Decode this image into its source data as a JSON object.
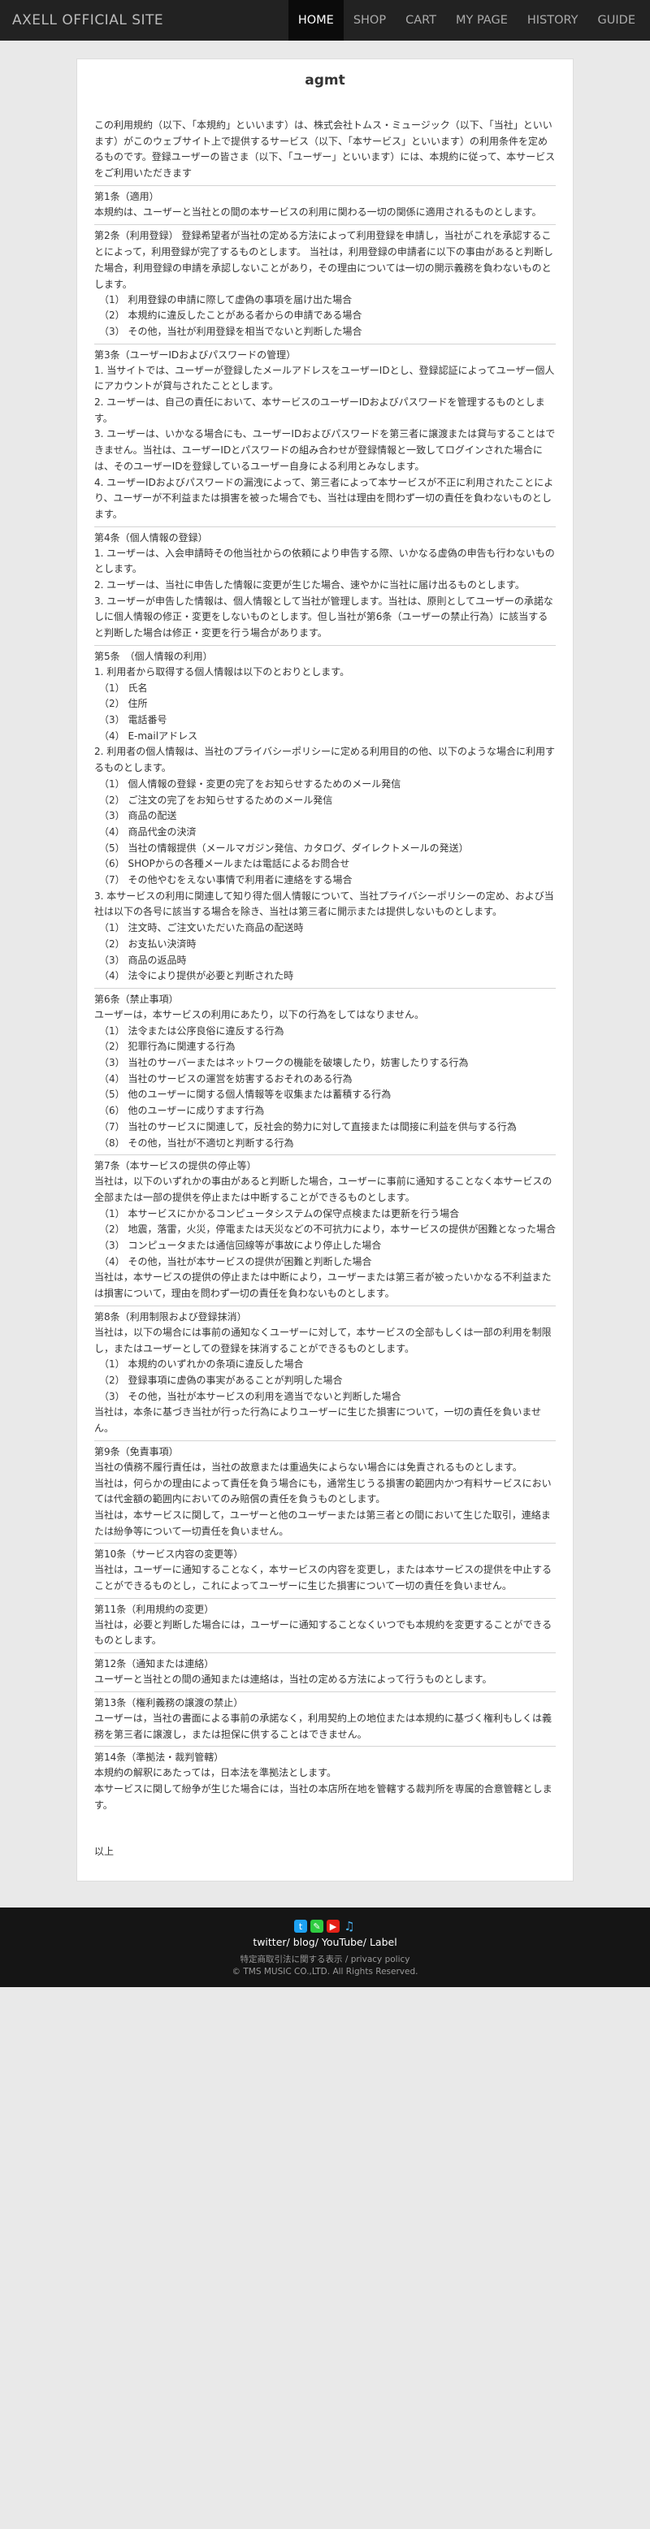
{
  "header": {
    "brand": "AXELL OFFICIAL SITE",
    "nav": [
      {
        "label": "HOME",
        "active": true
      },
      {
        "label": "SHOP",
        "active": false
      },
      {
        "label": "CART",
        "active": false
      },
      {
        "label": "MY PAGE",
        "active": false
      },
      {
        "label": "HISTORY",
        "active": false
      },
      {
        "label": "GUIDE",
        "active": false
      }
    ]
  },
  "doc": {
    "title": "agmt",
    "intro": "この利用規約（以下、「本規約」といいます）は、株式会社トムス・ミュージック（以下、「当社」といいます）がこのウェブサイト上で提供するサービス（以下、「本サービス」といいます）の利用条件を定めるものです。登録ユーザーの皆さま（以下、「ユーザー」といいます）には、本規約に従って、本サービスをご利用いただきます",
    "sections": [
      {
        "title": "第1条（適用）",
        "lines": [
          {
            "kind": "p",
            "text": "本規約は、ユーザーと当社との間の本サービスの利用に関わる一切の関係に適用されるものとします。"
          }
        ]
      },
      {
        "title": "第2条（利用登録） 登録希望者が当社の定める方法によって利用登録を申請し，当社がこれを承認することによって，利用登録が完了するものとします。 当社は，利用登録の申請者に以下の事由があると判断した場合，利用登録の申請を承認しないことがあり，その理由については一切の開示義務を負わないものとします。",
        "lines": [
          {
            "kind": "i",
            "text": "（1） 利用登録の申請に際して虚偽の事項を届け出た場合"
          },
          {
            "kind": "i",
            "text": "（2） 本規約に違反したことがある者からの申請である場合"
          },
          {
            "kind": "i",
            "text": "（3） その他，当社が利用登録を相当でないと判断した場合"
          }
        ]
      },
      {
        "title": "第3条（ユーザーIDおよびパスワードの管理）",
        "lines": [
          {
            "kind": "p",
            "text": "1. 当サイトでは、ユーザーが登録したメールアドレスをユーザーIDとし、登録認証によってユーザー個人にアカウントが貸与されたこととします。"
          },
          {
            "kind": "p",
            "text": "2. ユーザーは、自己の責任において、本サービスのユーザーIDおよびパスワードを管理するものとします。"
          },
          {
            "kind": "p",
            "text": "3. ユーザーは、いかなる場合にも、ユーザーIDおよびパスワードを第三者に譲渡または貸与することはできません。当社は、ユーザーIDとパスワードの組み合わせが登録情報と一致してログインされた場合には、そのユーザーIDを登録しているユーザー自身による利用とみなします。"
          },
          {
            "kind": "p",
            "text": "4. ユーザーIDおよびパスワードの漏洩によって、第三者によって本サービスが不正に利用されたことにより、ユーザーが不利益または損害を被った場合でも、当社は理由を問わず一切の責任を負わないものとします。"
          }
        ]
      },
      {
        "title": "第4条（個人情報の登録）",
        "lines": [
          {
            "kind": "p",
            "text": "1. ユーザーは、入会申請時その他当社からの依頼により申告する際、いかなる虚偽の申告も行わないものとします。"
          },
          {
            "kind": "p",
            "text": "2. ユーザーは、当社に申告した情報に変更が生じた場合、速やかに当社に届け出るものとします。"
          },
          {
            "kind": "p",
            "text": "3. ユーザーが申告した情報は、個人情報として当社が管理します。当社は、原則としてユーザーの承諾なしに個人情報の修正・変更をしないものとします。但し当社が第6条（ユーザーの禁止行為）に該当すると判断した場合は修正・変更を行う場合があります。"
          }
        ]
      },
      {
        "title": "第5条　（個人情報の利用）",
        "lines": [
          {
            "kind": "p",
            "text": "1. 利用者から取得する個人情報は以下のとおりとします。"
          },
          {
            "kind": "i",
            "text": "（1） 氏名"
          },
          {
            "kind": "i",
            "text": "（2） 住所"
          },
          {
            "kind": "i",
            "text": "（3） 電話番号"
          },
          {
            "kind": "i",
            "text": "（4） E-mailアドレス"
          },
          {
            "kind": "p",
            "text": "2. 利用者の個人情報は、当社のプライバシーポリシーに定める利用目的の他、以下のような場合に利用するものとします。"
          },
          {
            "kind": "i",
            "text": "（1） 個人情報の登録・変更の完了をお知らせするためのメール発信"
          },
          {
            "kind": "i",
            "text": "（2） ご注文の完了をお知らせするためのメール発信"
          },
          {
            "kind": "i",
            "text": "（3） 商品の配送"
          },
          {
            "kind": "i",
            "text": "（4） 商品代金の決済"
          },
          {
            "kind": "i",
            "text": "（5） 当社の情報提供（メールマガジン発信、カタログ、ダイレクトメールの発送）"
          },
          {
            "kind": "i",
            "text": "（6） SHOPからの各種メールまたは電話によるお問合せ"
          },
          {
            "kind": "i",
            "text": "（7） その他やむをえない事情で利用者に連絡をする場合"
          },
          {
            "kind": "p",
            "text": "3. 本サービスの利用に関連して知り得た個人情報について、当社プライバシーポリシーの定め、および当社は以下の各号に該当する場合を除き、当社は第三者に開示または提供しないものとします。"
          },
          {
            "kind": "i",
            "text": "（1） 注文時、ご注文いただいた商品の配送時"
          },
          {
            "kind": "i",
            "text": "（2） お支払い決済時"
          },
          {
            "kind": "i",
            "text": "（3） 商品の返品時"
          },
          {
            "kind": "i",
            "text": "（4） 法令により提供が必要と判断された時"
          }
        ]
      },
      {
        "title": "第6条（禁止事項）",
        "lines": [
          {
            "kind": "p",
            "text": "ユーザーは，本サービスの利用にあたり，以下の行為をしてはなりません。"
          },
          {
            "kind": "i",
            "text": "（1） 法令または公序良俗に違反する行為"
          },
          {
            "kind": "i",
            "text": "（2） 犯罪行為に関連する行為"
          },
          {
            "kind": "i",
            "text": "（3） 当社のサーバーまたはネットワークの機能を破壊したり，妨害したりする行為"
          },
          {
            "kind": "i",
            "text": "（4） 当社のサービスの運営を妨害するおそれのある行為"
          },
          {
            "kind": "i",
            "text": "（5） 他のユーザーに関する個人情報等を収集または蓄積する行為"
          },
          {
            "kind": "i",
            "text": "（6） 他のユーザーに成りすます行為"
          },
          {
            "kind": "i",
            "text": "（7） 当社のサービスに関連して，反社会的勢力に対して直接または間接に利益を供与する行為"
          },
          {
            "kind": "i",
            "text": "（8） その他，当社が不適切と判断する行為"
          }
        ]
      },
      {
        "title": "第7条（本サービスの提供の停止等）",
        "lines": [
          {
            "kind": "p",
            "text": "当社は，以下のいずれかの事由があると判断した場合，ユーザーに事前に通知することなく本サービスの全部または一部の提供を停止または中断することができるものとします。"
          },
          {
            "kind": "i",
            "text": "（1） 本サービスにかかるコンピュータシステムの保守点検または更新を行う場合"
          },
          {
            "kind": "i",
            "text": "（2） 地震，落雷，火災，停電または天災などの不可抗力により，本サービスの提供が困難となった場合"
          },
          {
            "kind": "i",
            "text": "（3） コンピュータまたは通信回線等が事故により停止した場合"
          },
          {
            "kind": "i",
            "text": "（4） その他，当社が本サービスの提供が困難と判断した場合"
          },
          {
            "kind": "p",
            "text": "当社は，本サービスの提供の停止または中断により，ユーザーまたは第三者が被ったいかなる不利益または損害について，理由を問わず一切の責任を負わないものとします。"
          }
        ]
      },
      {
        "title": "第8条（利用制限および登録抹消）",
        "lines": [
          {
            "kind": "p",
            "text": "当社は，以下の場合には事前の通知なくユーザーに対して，本サービスの全部もしくは一部の利用を制限し，またはユーザーとしての登録を抹消することができるものとします。"
          },
          {
            "kind": "i",
            "text": "（1） 本規約のいずれかの条項に違反した場合"
          },
          {
            "kind": "i",
            "text": "（2） 登録事項に虚偽の事実があることが判明した場合"
          },
          {
            "kind": "i",
            "text": "（3） その他，当社が本サービスの利用を適当でないと判断した場合"
          },
          {
            "kind": "p",
            "text": "当社は，本条に基づき当社が行った行為によりユーザーに生じた損害について，一切の責任を負いません。"
          }
        ]
      },
      {
        "title": "第9条（免責事項）",
        "lines": [
          {
            "kind": "p",
            "text": "当社の債務不履行責任は，当社の故意または重過失によらない場合には免責されるものとします。"
          },
          {
            "kind": "p",
            "text": "当社は，何らかの理由によって責任を負う場合にも，通常生じうる損害の範囲内かつ有料サービスにおいては代金額の範囲内においてのみ賠償の責任を負うものとします。"
          },
          {
            "kind": "p",
            "text": "当社は，本サービスに関して，ユーザーと他のユーザーまたは第三者との間において生じた取引，連絡または紛争等について一切責任を負いません。"
          }
        ]
      },
      {
        "title": "第10条（サービス内容の変更等）",
        "lines": [
          {
            "kind": "p",
            "text": "当社は，ユーザーに通知することなく，本サービスの内容を変更し，または本サービスの提供を中止することができるものとし，これによってユーザーに生じた損害について一切の責任を負いません。"
          }
        ]
      },
      {
        "title": "第11条（利用規約の変更）",
        "lines": [
          {
            "kind": "p",
            "text": "当社は，必要と判断した場合には，ユーザーに通知することなくいつでも本規約を変更することができるものとします。"
          }
        ]
      },
      {
        "title": "第12条（通知または連絡）",
        "lines": [
          {
            "kind": "p",
            "text": "ユーザーと当社との間の通知または連絡は，当社の定める方法によって行うものとします。"
          }
        ]
      },
      {
        "title": "第13条（権利義務の譲渡の禁止）",
        "lines": [
          {
            "kind": "p",
            "text": "ユーザーは，当社の書面による事前の承諾なく，利用契約上の地位または本規約に基づく権利もしくは義務を第三者に譲渡し，または担保に供することはできません。"
          }
        ]
      },
      {
        "title": "第14条（準拠法・裁判管轄）",
        "lines": [
          {
            "kind": "p",
            "text": "本規約の解釈にあたっては，日本法を準拠法とします。"
          },
          {
            "kind": "p",
            "text": "本サービスに関して紛争が生じた場合には，当社の本店所在地を管轄する裁判所を専属的合意管轄とします。"
          }
        ]
      }
    ],
    "closing": "以上"
  },
  "footer": {
    "icons": [
      {
        "name": "twitter-icon",
        "glyph": "t",
        "color": "#1da1f2"
      },
      {
        "name": "blog-icon",
        "glyph": "✎",
        "color": "#2ecc40"
      },
      {
        "name": "youtube-icon",
        "glyph": "▶",
        "color": "#e62117"
      },
      {
        "name": "label-icon",
        "glyph": "♫",
        "color": "#4ab3f4"
      }
    ],
    "links": [
      "twitter",
      "blog",
      "YouTube",
      "Label"
    ],
    "legal_links": [
      "特定商取引法に関する表示",
      "privacy policy"
    ],
    "copyright": "© TMS MUSIC CO.,LTD. All Rights Reserved."
  }
}
